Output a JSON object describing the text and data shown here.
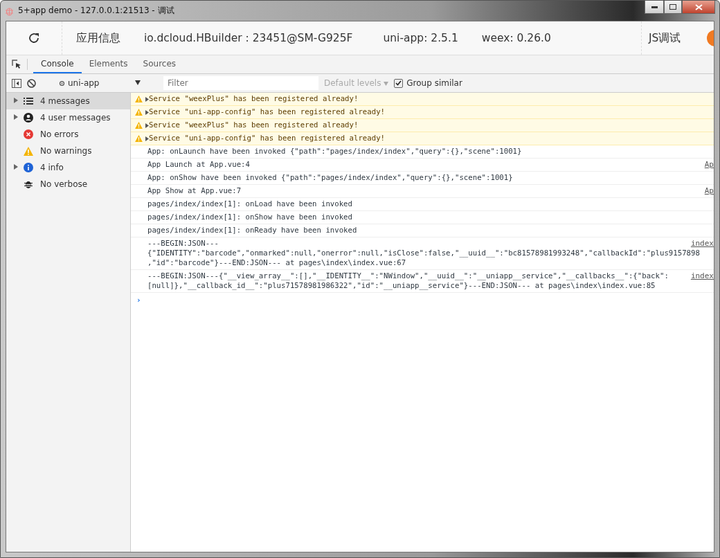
{
  "window": {
    "title": "5+app demo - 127.0.0.1:21513 - 调试"
  },
  "header": {
    "items": [
      "应用信息",
      "io.dcloud.HBuilder : 23451@SM-G925F",
      "uni-app: 2.5.1",
      "weex: 0.26.0"
    ],
    "debug_label": "JS调试"
  },
  "tabs": [
    {
      "label": "Console",
      "selected": true
    },
    {
      "label": "Elements",
      "selected": false
    },
    {
      "label": "Sources",
      "selected": false
    }
  ],
  "toolbar": {
    "context": "uni-app",
    "filter": {
      "placeholder": "Filter"
    },
    "levels": {
      "label": "Default levels",
      "disabled": true
    },
    "group_similar": {
      "label": "Group similar",
      "checked": true
    }
  },
  "sidebar": {
    "items": [
      {
        "kind": "list",
        "label": "4 messages",
        "expandable": true,
        "selected": true
      },
      {
        "kind": "user",
        "label": "4 user messages",
        "expandable": true,
        "selected": false
      },
      {
        "kind": "error",
        "label": "No errors",
        "expandable": false,
        "selected": false
      },
      {
        "kind": "warning",
        "label": "No warnings",
        "expandable": false,
        "selected": false
      },
      {
        "kind": "info",
        "label": "4 info",
        "expandable": true,
        "selected": false
      },
      {
        "kind": "verbose",
        "label": "No verbose",
        "expandable": false,
        "selected": false
      }
    ]
  },
  "console": {
    "entries": [
      {
        "kind": "warning",
        "lines": [
          "Service \"weexPlus\" has been registered already!"
        ]
      },
      {
        "kind": "warning",
        "lines": [
          "Service \"uni-app-config\" has been registered already!"
        ]
      },
      {
        "kind": "warning",
        "lines": [
          "Service \"weexPlus\" has been registered already!"
        ]
      },
      {
        "kind": "warning",
        "lines": [
          "Service \"uni-app-config\" has been registered already!"
        ]
      },
      {
        "kind": "log",
        "lines": [
          "App: onLaunch have been invoked {\"path\":\"pages/index/index\",\"query\":{},\"scene\":1001}"
        ]
      },
      {
        "kind": "log",
        "lines": [
          "App Launch at App.vue:4"
        ],
        "source": "Ap"
      },
      {
        "kind": "log",
        "lines": [
          "App: onShow have been invoked {\"path\":\"pages/index/index\",\"query\":{},\"scene\":1001}"
        ]
      },
      {
        "kind": "log",
        "lines": [
          "App Show at App.vue:7"
        ],
        "source": "Ap"
      },
      {
        "kind": "log",
        "lines": [
          "pages/index/index[1]: onLoad have been invoked"
        ]
      },
      {
        "kind": "log",
        "lines": [
          "pages/index/index[1]: onShow have been invoked"
        ]
      },
      {
        "kind": "log",
        "lines": [
          "pages/index/index[1]: onReady have been invoked"
        ]
      },
      {
        "kind": "log",
        "lines": [
          "---BEGIN:JSON---",
          "{\"IDENTITY\":\"barcode\",\"onmarked\":null,\"onerror\":null,\"isClose\":false,\"__uuid__\":\"bc81578981993248\",\"callbackId\":\"plus9157898",
          ",\"id\":\"barcode\"}---END:JSON--- at pages\\index\\index.vue:67"
        ],
        "source": "index"
      },
      {
        "kind": "log",
        "lines": [
          "---BEGIN:JSON---{\"__view_array__\":[],\"__IDENTITY__\":\"NWindow\",\"__uuid__\":\"__uniapp__service\",\"__callbacks__\":{\"back\":",
          "[null]},\"__callback_id__\":\"plus71578981986322\",\"id\":\"__uniapp__service\"}---END:JSON--- at pages\\index\\index.vue:85"
        ],
        "source": "index"
      }
    ],
    "prompt": "›"
  }
}
